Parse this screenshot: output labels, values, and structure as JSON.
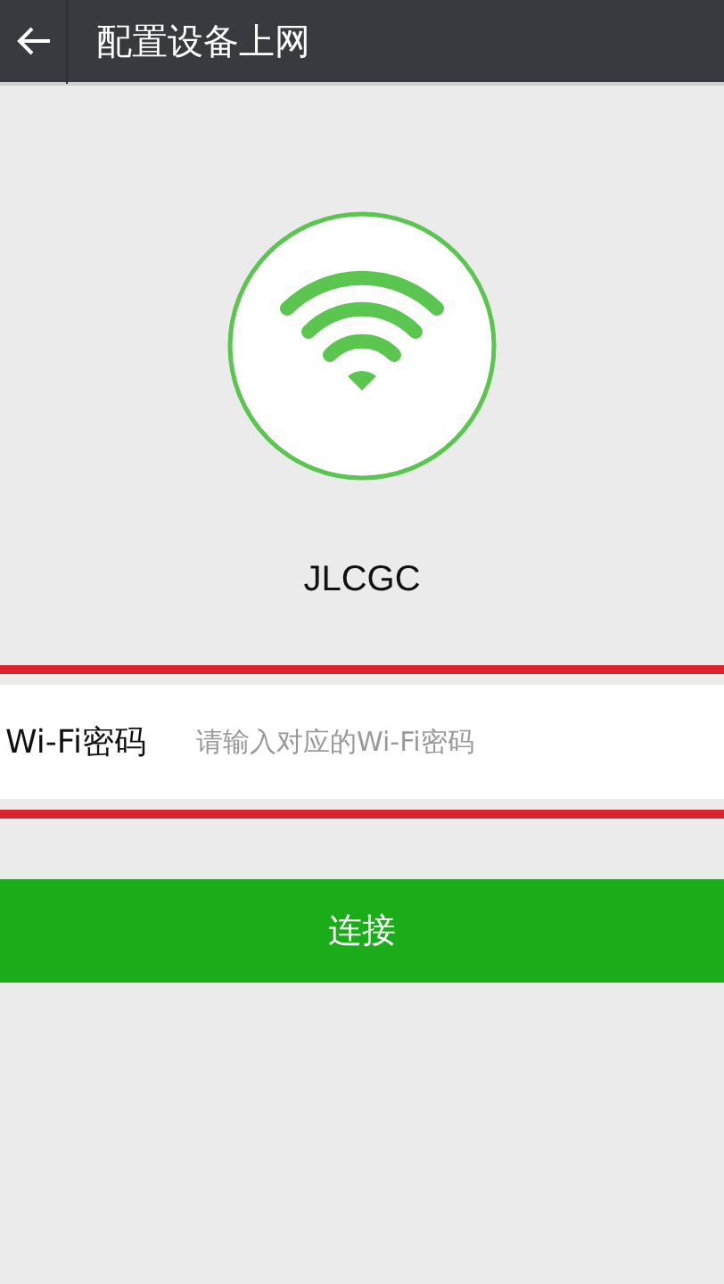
{
  "header": {
    "title": "配置设备上网"
  },
  "device": {
    "name": "JLCGC"
  },
  "password": {
    "label": "Wi-Fi密码",
    "placeholder": "请输入对应的Wi-Fi密码"
  },
  "connect_button": {
    "label": "连接"
  }
}
